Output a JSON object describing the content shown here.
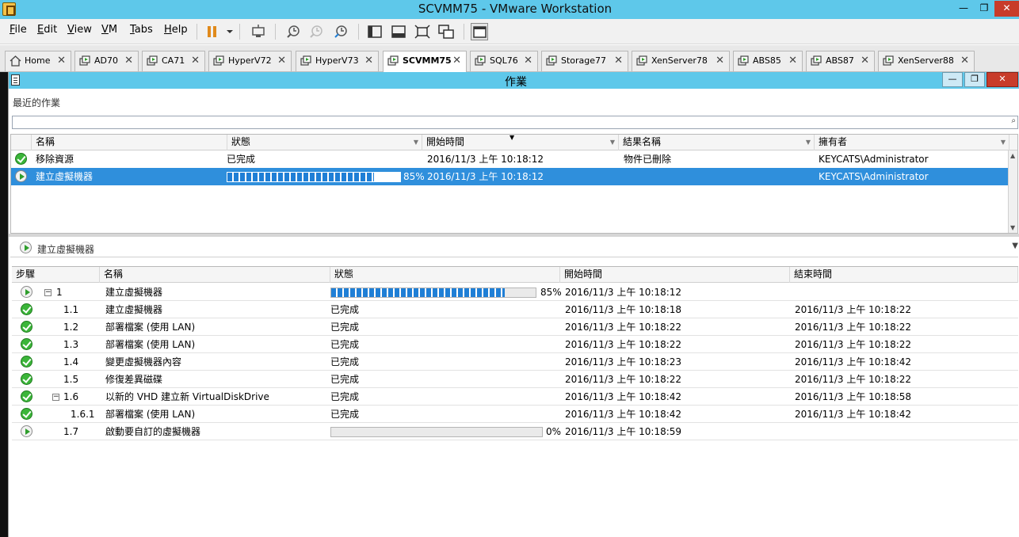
{
  "window": {
    "title": "SCVMM75 - VMware Workstation",
    "min_label": "—",
    "max_label": "❐",
    "close_label": "✕"
  },
  "menu": [
    {
      "key": "F",
      "rest": "ile"
    },
    {
      "key": "E",
      "rest": "dit"
    },
    {
      "key": "V",
      "rest": "iew"
    },
    {
      "key": "V",
      "rest": "M",
      "full": "VM"
    },
    {
      "key": "T",
      "rest": "abs"
    },
    {
      "key": "H",
      "rest": "elp"
    }
  ],
  "tabs": [
    {
      "label": "Home",
      "close": "✕"
    },
    {
      "label": "AD70",
      "close": "✕"
    },
    {
      "label": "CA71",
      "close": "✕"
    },
    {
      "label": "HyperV72",
      "close": "✕"
    },
    {
      "label": "HyperV73",
      "close": "✕"
    },
    {
      "label": "SCVMM75",
      "close": "✕"
    },
    {
      "label": "SQL76",
      "close": "✕"
    },
    {
      "label": "Storage77",
      "close": "✕"
    },
    {
      "label": "XenServer78",
      "close": "✕"
    },
    {
      "label": "ABS85",
      "close": "✕"
    },
    {
      "label": "ABS87",
      "close": "✕"
    },
    {
      "label": "XenServer88",
      "close": "✕"
    }
  ],
  "jobs": {
    "title": "作業",
    "recent_label": "最近的作業",
    "search_placeholder": "",
    "columns": [
      "名稱",
      "狀態",
      "開始時間",
      "結果名稱",
      "擁有者"
    ],
    "rows": [
      {
        "name": "移除資源",
        "status": "已完成",
        "start": "2016/11/3 上午 10:18:12",
        "result": "物件已刪除",
        "owner": "KEYCATS\\Administrator",
        "progress": null,
        "icon": "check"
      },
      {
        "name": "建立虛擬機器",
        "status": "",
        "start": "2016/11/3 上午 10:18:12",
        "result": "",
        "owner": "KEYCATS\\Administrator",
        "progress": 85,
        "progress_label": "85%",
        "icon": "play"
      }
    ]
  },
  "detail": {
    "title": "建立虛擬機器",
    "columns": [
      "步驟",
      "名稱",
      "狀態",
      "開始時間",
      "結束時間"
    ],
    "steps": [
      {
        "step": "1",
        "name": "建立虛擬機器",
        "status": "",
        "progress": 85,
        "progress_label": "85%",
        "start": "2016/11/3 上午 10:18:12",
        "end": "",
        "icon": "play",
        "expander": "−",
        "level": 0
      },
      {
        "step": "1.1",
        "name": "建立虛擬機器",
        "status": "已完成",
        "start": "2016/11/3 上午 10:18:18",
        "end": "2016/11/3 上午 10:18:22",
        "icon": "check",
        "level": 1
      },
      {
        "step": "1.2",
        "name": "部署檔案 (使用 LAN)",
        "status": "已完成",
        "start": "2016/11/3 上午 10:18:22",
        "end": "2016/11/3 上午 10:18:22",
        "icon": "check",
        "level": 1
      },
      {
        "step": "1.3",
        "name": "部署檔案 (使用 LAN)",
        "status": "已完成",
        "start": "2016/11/3 上午 10:18:22",
        "end": "2016/11/3 上午 10:18:22",
        "icon": "check",
        "level": 1
      },
      {
        "step": "1.4",
        "name": "變更虛擬機器內容",
        "status": "已完成",
        "start": "2016/11/3 上午 10:18:23",
        "end": "2016/11/3 上午 10:18:42",
        "icon": "check",
        "level": 1
      },
      {
        "step": "1.5",
        "name": "修復差異磁碟",
        "status": "已完成",
        "start": "2016/11/3 上午 10:18:22",
        "end": "2016/11/3 上午 10:18:22",
        "icon": "check",
        "level": 1
      },
      {
        "step": "1.6",
        "name": "以新的 VHD 建立新 VirtualDiskDrive",
        "status": "已完成",
        "start": "2016/11/3 上午 10:18:42",
        "end": "2016/11/3 上午 10:18:58",
        "icon": "check",
        "expander": "−",
        "level": 1
      },
      {
        "step": "1.6.1",
        "name": "部署檔案 (使用 LAN)",
        "status": "已完成",
        "start": "2016/11/3 上午 10:18:42",
        "end": "2016/11/3 上午 10:18:42",
        "icon": "check",
        "level": 2
      },
      {
        "step": "1.7",
        "name": "啟動要自訂的虛擬機器",
        "status": "",
        "progress": 0,
        "progress_label": "0%",
        "start": "2016/11/3 上午 10:18:59",
        "end": "",
        "icon": "play",
        "level": 1
      }
    ]
  },
  "colors": {
    "titlebar": "#5ec8ea",
    "selection": "#2f8fdc",
    "progress": "#1f7fd6",
    "check": "#3bb539"
  }
}
